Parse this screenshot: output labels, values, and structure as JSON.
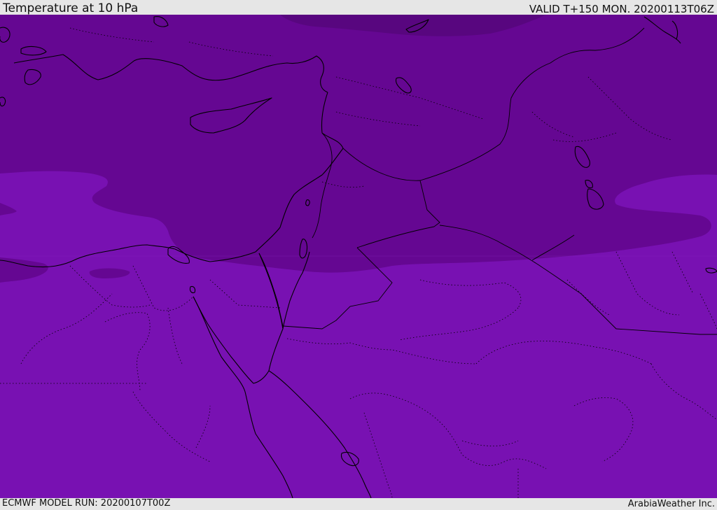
{
  "header": {
    "title": "Temperature at 10 hPa",
    "valid": "VALID T+150 MON. 20200113T06Z"
  },
  "footer": {
    "model_run": "ECMWF MODEL RUN: 20200107T00Z",
    "credit": "ArabiaWeather Inc."
  },
  "colors": {
    "band_cold": "#58067f",
    "band_dark": "#650792",
    "band_mid": "#7812b0",
    "band_light": "#7811b2",
    "coast": "#000000",
    "borders": "#000000",
    "frame": "#e6e6e6"
  }
}
